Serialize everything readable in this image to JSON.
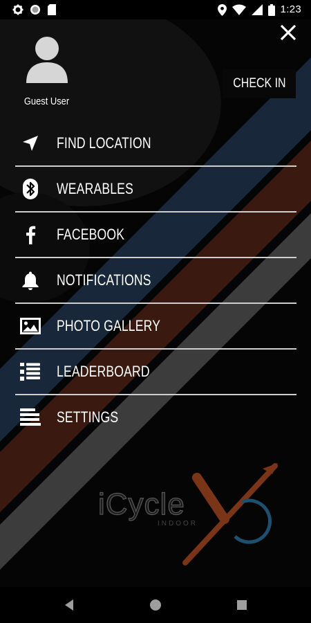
{
  "status_bar": {
    "time": "1:23",
    "left_icons": [
      "settings-icon",
      "circle-icon",
      "sd-card-icon"
    ],
    "right_icons": [
      "location-pin-icon",
      "wifi-icon",
      "signal-icon",
      "battery-icon"
    ]
  },
  "drawer": {
    "user_name": "Guest User",
    "check_in_label": "CHECK IN",
    "close_icon": "close-icon",
    "menu": [
      {
        "label": "FIND LOCATION",
        "icon": "navigation-arrow-icon"
      },
      {
        "label": "WEARABLES",
        "icon": "bluetooth-icon"
      },
      {
        "label": "FACEBOOK",
        "icon": "facebook-icon"
      },
      {
        "label": "NOTIFICATIONS",
        "icon": "bell-icon"
      },
      {
        "label": "PHOTO GALLERY",
        "icon": "image-icon"
      },
      {
        "label": "LEADERBOARD",
        "icon": "ranked-list-icon"
      },
      {
        "label": "SETTINGS",
        "icon": "settings-list-icon"
      }
    ]
  },
  "brand": {
    "logo_text": "iCycle",
    "logo_sub": "INDOOR",
    "logo_mark": "X"
  },
  "colors": {
    "background": "#000000",
    "stripe_blue": "#18283a",
    "stripe_rust": "#3a1a10",
    "stripe_gray": "#3c3c3c",
    "logo_blue": "#1e4f6e",
    "logo_rust": "#7a3418",
    "text": "#ffffff"
  },
  "nav_bar": [
    "back-icon",
    "home-icon",
    "recents-icon"
  ]
}
